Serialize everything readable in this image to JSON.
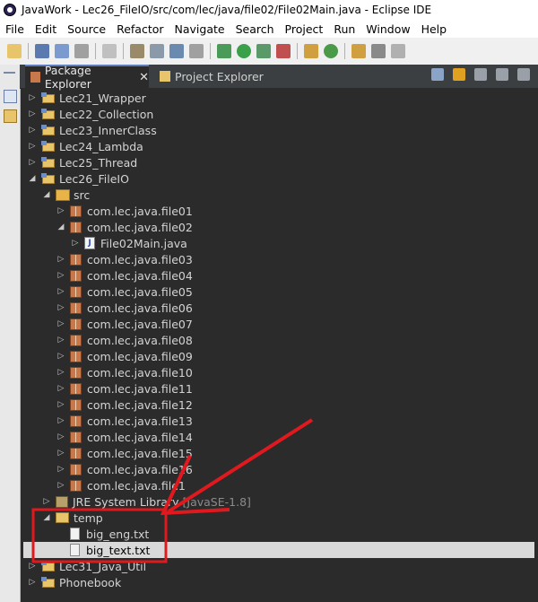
{
  "window": {
    "title": "JavaWork - Lec26_FileIO/src/com/lec/java/file02/File02Main.java - Eclipse IDE"
  },
  "menu": [
    "File",
    "Edit",
    "Source",
    "Refactor",
    "Navigate",
    "Search",
    "Project",
    "Run",
    "Window",
    "Help"
  ],
  "tabs": {
    "package_explorer": "Package Explorer",
    "project_explorer": "Project Explorer",
    "close": "✕"
  },
  "tree": {
    "projects_top": [
      "Lec21_Wrapper",
      "Lec22_Collection",
      "Lec23_InnerClass",
      "Lec24_Lambda",
      "Lec25_Thread"
    ],
    "open_project": "Lec26_FileIO",
    "src": "src",
    "packages_a": [
      "com.lec.java.file01",
      "com.lec.java.file02"
    ],
    "file": "File02Main.java",
    "packages_b": [
      "com.lec.java.file03",
      "com.lec.java.file04",
      "com.lec.java.file05",
      "com.lec.java.file06",
      "com.lec.java.file07",
      "com.lec.java.file08",
      "com.lec.java.file09",
      "com.lec.java.file10",
      "com.lec.java.file11",
      "com.lec.java.file12",
      "com.lec.java.file13",
      "com.lec.java.file14",
      "com.lec.java.file15",
      "com.lec.java.file16",
      "com.lec.java.file1"
    ],
    "jre_label": "JRE System Library",
    "jre_suffix": "[JavaSE-1.8]",
    "temp_folder": "temp",
    "temp_files": [
      "big_eng.txt",
      "big_text.txt"
    ],
    "projects_bottom": [
      "Lec31_Java_Util",
      "Phonebook"
    ]
  },
  "annotation_color": "#e0191e"
}
